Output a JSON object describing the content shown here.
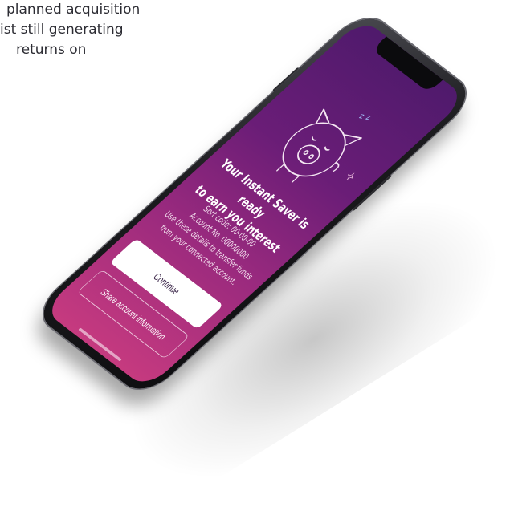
{
  "background_text": {
    "line1": "planned acquisition",
    "line2": "ist still generating",
    "line3": "returns on"
  },
  "screen": {
    "headline_line1": "Your Instant Saver is ready",
    "headline_line2": "to earn you interest",
    "sort_code": "Sort code: 00-00-00",
    "account_no": "Account No. 00000000",
    "instruction_line1": "Use these details to transfer funds",
    "instruction_line2": "from your connected account.",
    "continue_label": "Continue",
    "share_label": "Share account information",
    "zzz": "z z"
  },
  "colors": {
    "gradient_top": "#4f1a6c",
    "gradient_bottom": "#c63a7f",
    "button_bg": "#ffffff"
  },
  "icons": {
    "illustration": "sleeping-piggy-bank-icon",
    "sparkle": "sparkle-icon"
  }
}
